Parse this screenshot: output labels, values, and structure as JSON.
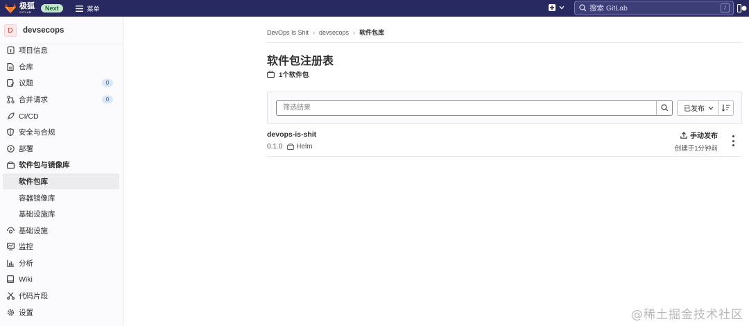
{
  "topbar": {
    "logo_text": "极狐",
    "logo_sub": "GITLAB",
    "next_badge": "Next",
    "menu_label": "菜单",
    "search_placeholder": "搜索 GitLab",
    "search_shortcut": "/"
  },
  "sidebar": {
    "project_initial": "D",
    "project_name": "devsecops",
    "items": [
      {
        "label": "项目信息",
        "icon": "info-icon"
      },
      {
        "label": "仓库",
        "icon": "file-icon"
      },
      {
        "label": "议题",
        "icon": "issues-icon",
        "count": "0"
      },
      {
        "label": "合并请求",
        "icon": "merge-request-icon",
        "count": "0"
      },
      {
        "label": "CI/CD",
        "icon": "rocket-icon"
      },
      {
        "label": "安全与合规",
        "icon": "shield-icon"
      },
      {
        "label": "部署",
        "icon": "deploy-icon"
      },
      {
        "label": "软件包与镜像库",
        "icon": "package-icon"
      },
      {
        "label": "基础设施",
        "icon": "infrastructure-icon"
      },
      {
        "label": "监控",
        "icon": "monitor-icon"
      },
      {
        "label": "分析",
        "icon": "chart-icon"
      },
      {
        "label": "Wiki",
        "icon": "book-icon"
      },
      {
        "label": "代码片段",
        "icon": "snippet-icon"
      },
      {
        "label": "设置",
        "icon": "settings-icon"
      }
    ],
    "sub_items": [
      {
        "label": "软件包库",
        "active": true
      },
      {
        "label": "容器镜像库"
      },
      {
        "label": "基础设施库"
      }
    ]
  },
  "breadcrumb": [
    "DevOps Is Shit",
    "devsecops",
    "软件包库"
  ],
  "main": {
    "title": "软件包注册表",
    "package_count": "1个软件包",
    "filter_placeholder": "筛选结果",
    "sort_label": "已发布"
  },
  "packages": [
    {
      "name": "devops-is-shit",
      "version": "0.1.0",
      "type": "Helm",
      "publish_label": "手动发布",
      "created": "创建于1分钟前"
    }
  ],
  "watermark": "@稀土掘金技术社区"
}
